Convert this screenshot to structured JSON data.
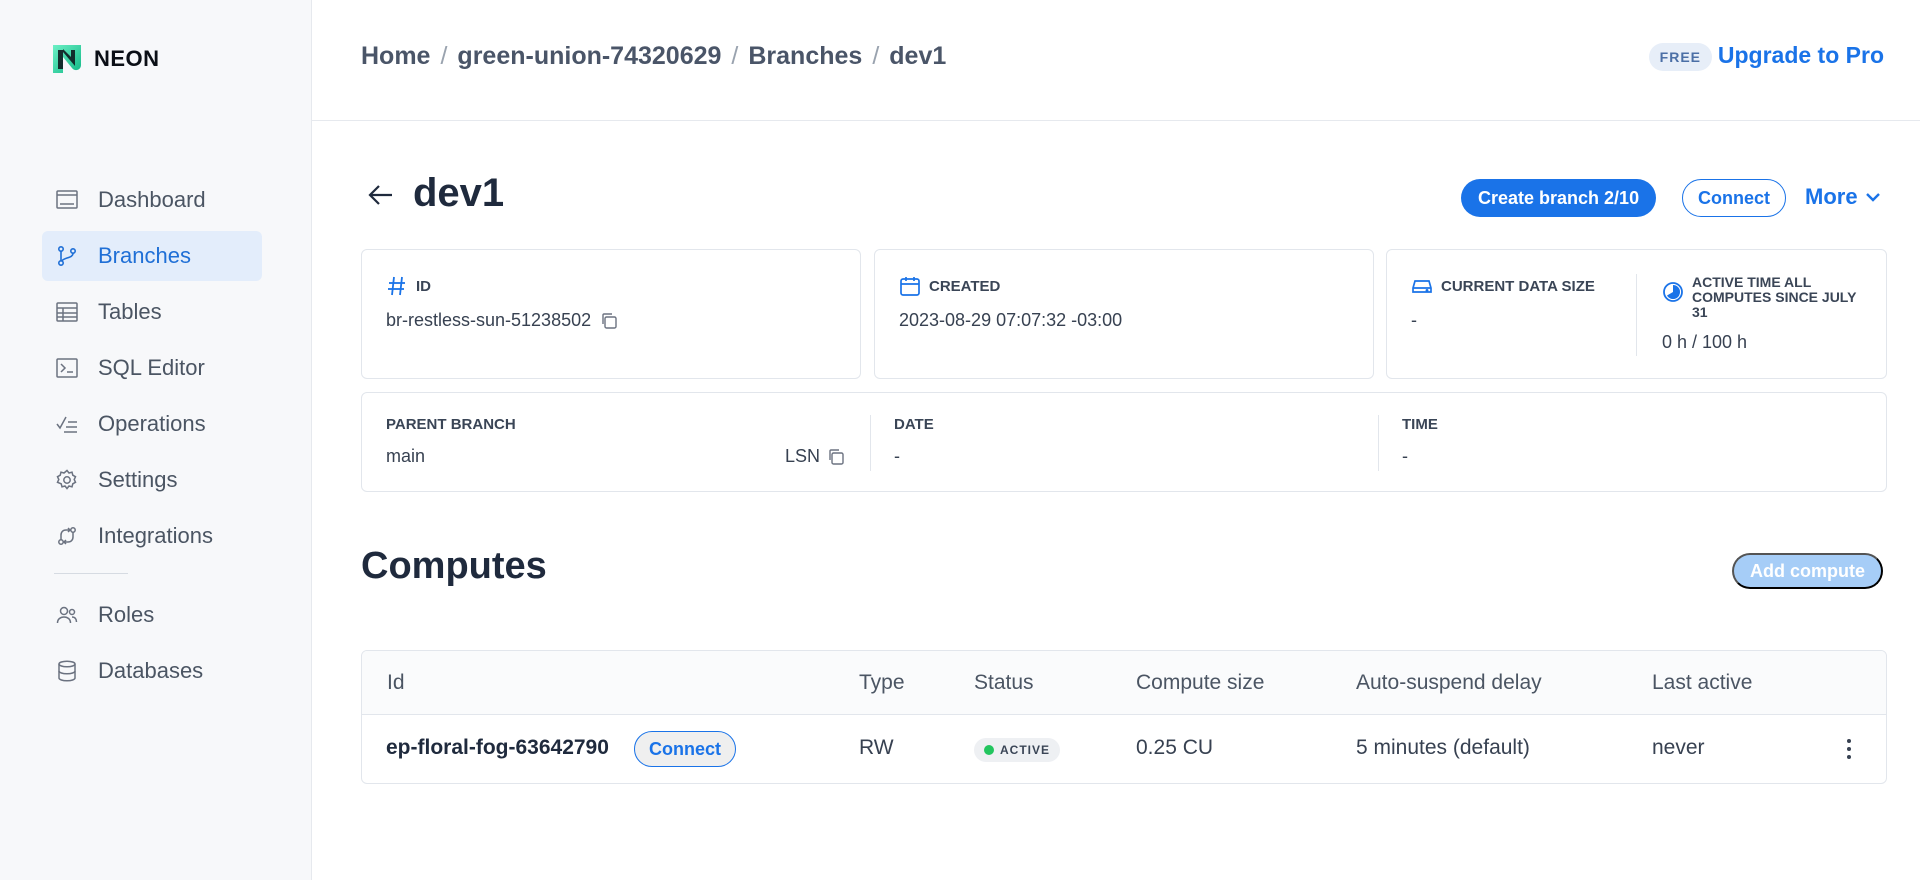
{
  "app": {
    "logo_text": "NEON"
  },
  "sidebar": {
    "items": [
      {
        "label": "Dashboard",
        "icon": "dashboard-icon"
      },
      {
        "label": "Branches",
        "icon": "branch-icon",
        "active": true
      },
      {
        "label": "Tables",
        "icon": "table-icon"
      },
      {
        "label": "SQL Editor",
        "icon": "sql-editor-icon"
      },
      {
        "label": "Operations",
        "icon": "operations-icon"
      },
      {
        "label": "Settings",
        "icon": "gear-icon"
      },
      {
        "label": "Integrations",
        "icon": "integrations-icon"
      }
    ],
    "items2": [
      {
        "label": "Roles",
        "icon": "users-icon"
      },
      {
        "label": "Databases",
        "icon": "database-icon"
      }
    ]
  },
  "header": {
    "breadcrumbs": [
      "Home",
      "green-union-74320629",
      "Branches",
      "dev1"
    ],
    "plan_badge": "FREE",
    "upgrade_label": "Upgrade to Pro"
  },
  "page": {
    "title": "dev1",
    "create_branch_label": "Create branch 2/10",
    "connect_label": "Connect",
    "more_label": "More"
  },
  "info": {
    "id_label": "ID",
    "id_value": "br-restless-sun-51238502",
    "created_label": "CREATED",
    "created_value": "2023-08-29 07:07:32 -03:00",
    "data_size_label": "CURRENT DATA SIZE",
    "data_size_value": "-",
    "active_time_label": "ACTIVE TIME ALL COMPUTES SINCE JULY 31",
    "active_time_value": "0 h / 100 h",
    "parent_label": "PARENT BRANCH",
    "parent_value": "main",
    "lsn_label": "LSN",
    "date_label": "DATE",
    "date_value": "-",
    "time_label": "TIME",
    "time_value": "-"
  },
  "computes": {
    "title": "Computes",
    "add_label": "Add compute",
    "columns": [
      "Id",
      "Type",
      "Status",
      "Compute size",
      "Auto-suspend delay",
      "Last active"
    ],
    "rows": [
      {
        "id": "ep-floral-fog-63642790",
        "connect_label": "Connect",
        "type": "RW",
        "status": "ACTIVE",
        "size": "0.25 CU",
        "suspend": "5 minutes (default)",
        "last_active": "never"
      }
    ]
  },
  "colors": {
    "accent": "#1a73e8",
    "active_bg": "#e3edfb",
    "status_active": "#22c55e",
    "logo_green": "#3ee6a0"
  }
}
